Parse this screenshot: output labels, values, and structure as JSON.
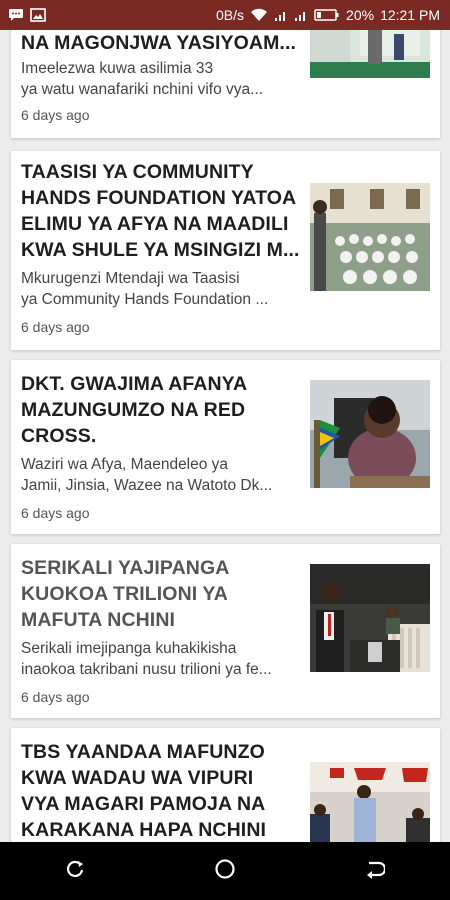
{
  "status_bar": {
    "speed": "0B/s",
    "battery": "20%",
    "time": "12:21 PM",
    "icons": [
      "chat-bubble-icon",
      "image-icon",
      "wifi-icon",
      "signal-icon",
      "signal-icon",
      "battery-icon"
    ]
  },
  "articles": [
    {
      "title_line": "NA MAGONJWA YASIYOAM...",
      "excerpt_lines": [
        "Imeelezwa kuwa asilimia 33",
        "ya watu wanafariki nchini vifo vya..."
      ],
      "age": "6 days ago"
    },
    {
      "title_lines": [
        "TAASISI YA COMMUNITY",
        "HANDS FOUNDATION YATOA",
        "ELIMU YA AFYA NA MAADILI",
        "KWA SHULE YA MSINGIZI M..."
      ],
      "excerpt_lines": [
        "Mkurugenzi Mtendaji wa Taasisi",
        "ya Community Hands Foundation ..."
      ],
      "age": "6 days ago"
    },
    {
      "title_lines": [
        "DKT. GWAJIMA AFANYA",
        "MAZUNGUMZO NA RED",
        "CROSS."
      ],
      "excerpt_lines": [
        "Waziri wa Afya, Maendeleo ya",
        "Jamii, Jinsia, Wazee na Watoto Dk..."
      ],
      "age": "6 days ago"
    },
    {
      "title_lines": [
        "SERIKALI YAJIPANGA",
        "KUOKOA TRILIONI YA",
        "MAFUTA NCHINI"
      ],
      "excerpt_lines": [
        "Serikali imejipanga kuhakikisha",
        "inaokoa takribani nusu trilioni ya fe..."
      ],
      "age": "6 days ago"
    },
    {
      "title_lines": [
        "TBS YAANDAA MAFUNZO",
        "KWA WADAU WA VIPURI",
        "VYA MAGARI PAMOJA NA",
        "KARAKANA HAPA NCHINI"
      ]
    }
  ],
  "nav": {
    "icons": [
      "recent-apps-icon",
      "home-icon",
      "back-icon"
    ]
  },
  "colors": {
    "status_bar": "#7a2a22",
    "background": "#ececec",
    "card": "#ffffff",
    "nav_bar": "#000000"
  }
}
